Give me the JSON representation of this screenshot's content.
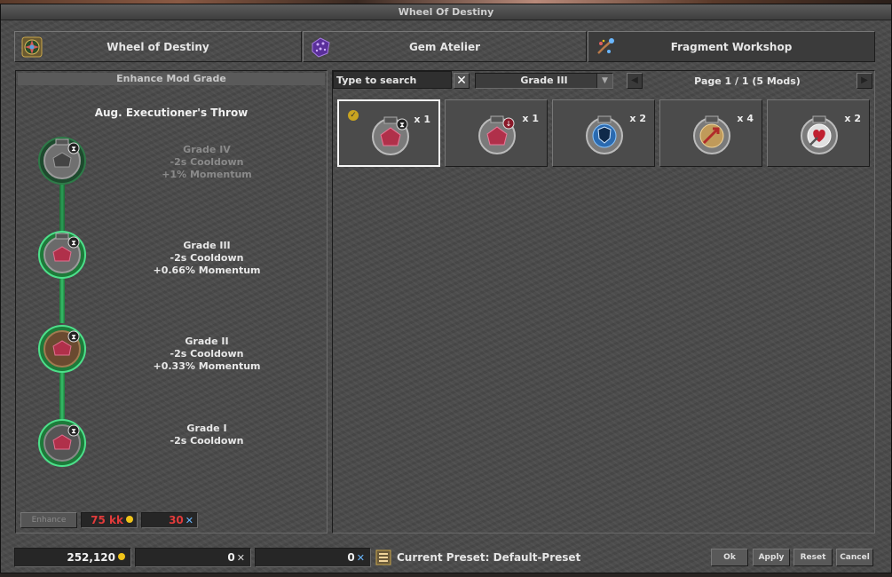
{
  "window": {
    "title": "Wheel Of Destiny"
  },
  "tabs": [
    {
      "label": "Wheel of Destiny",
      "icon": "wheel-icon"
    },
    {
      "label": "Gem Atelier",
      "icon": "gem-icon"
    },
    {
      "label": "Fragment Workshop",
      "icon": "fragment-icon"
    }
  ],
  "left": {
    "header": "Enhance Mod Grade",
    "skill_name": "Aug. Executioner's Throw",
    "grades": [
      {
        "title": "Grade IV",
        "lines": [
          "-2s Cooldown",
          "+1% Momentum"
        ],
        "locked": true
      },
      {
        "title": "Grade III",
        "lines": [
          "-2s Cooldown",
          "+0.66% Momentum"
        ],
        "locked": false
      },
      {
        "title": "Grade II",
        "lines": [
          "-2s Cooldown",
          "+0.33% Momentum"
        ],
        "locked": false
      },
      {
        "title": "Grade I",
        "lines": [
          "-2s Cooldown"
        ],
        "locked": false
      }
    ],
    "enhance_label": "Enhance",
    "cost_gold": "75 kk",
    "cost_fragments": "30"
  },
  "right": {
    "search_placeholder": "Type to search",
    "grade_filter": "Grade III",
    "page_info": "Page 1 / 1 (5 Mods)",
    "mods": [
      {
        "count": "x 1",
        "selected": true,
        "icon": "executioner-throw-mod-icon"
      },
      {
        "count": "x 1",
        "selected": false,
        "icon": "downward-strike-mod-icon"
      },
      {
        "count": "x 2",
        "selected": false,
        "icon": "shield-mod-icon"
      },
      {
        "count": "x 4",
        "selected": false,
        "icon": "arrow-mod-icon"
      },
      {
        "count": "x 2",
        "selected": false,
        "icon": "heart-strike-mod-icon"
      }
    ]
  },
  "bottom": {
    "gold_balance": "252,120",
    "lesser_fragments": "0",
    "greater_fragments": "0",
    "preset_label": "Current Preset: Default-Preset",
    "buttons": {
      "ok": "Ok",
      "apply": "Apply",
      "reset": "Reset",
      "cancel": "Cancel"
    }
  },
  "colors": {
    "accent_green": "#36c06a",
    "cost_red": "#e23b3b",
    "gold": "#f0c419"
  }
}
